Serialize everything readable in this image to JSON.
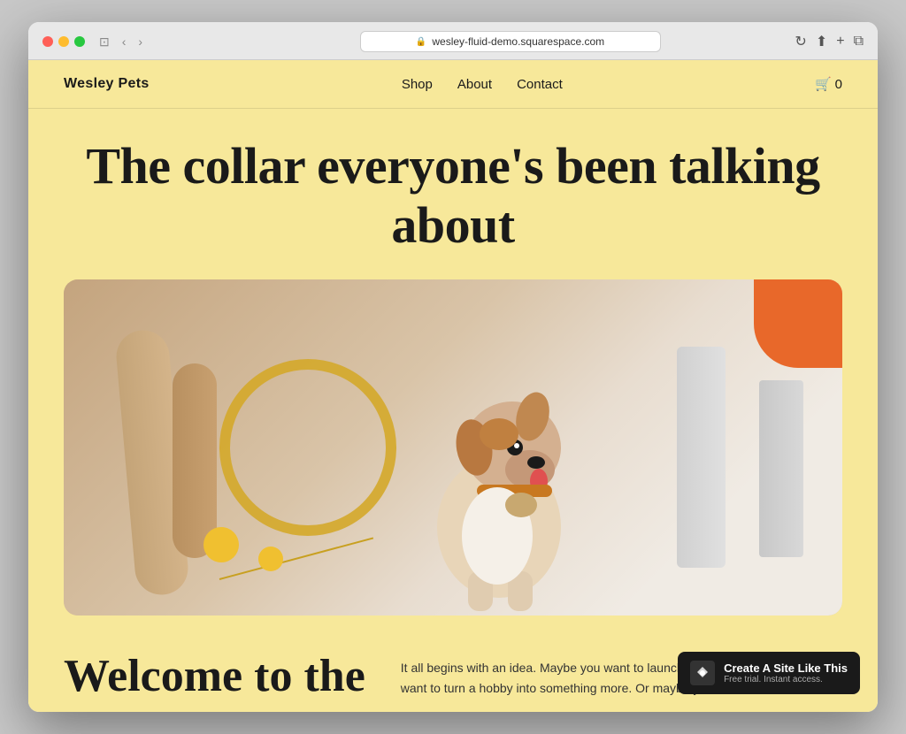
{
  "browser": {
    "url": "wesley-fluid-demo.squarespace.com",
    "back_btn": "‹",
    "forward_btn": "›",
    "refresh_btn": "↻",
    "share_btn": "⬆",
    "new_tab_btn": "+",
    "duplicate_btn": "⧉",
    "window_btn": "⊡"
  },
  "nav": {
    "logo": "Wesley Pets",
    "links": [
      {
        "label": "Shop",
        "href": "#"
      },
      {
        "label": "About",
        "href": "#"
      },
      {
        "label": "Contact",
        "href": "#"
      }
    ],
    "cart_icon": "🛒",
    "cart_count": "0"
  },
  "hero": {
    "title": "The collar everyone's been talking about"
  },
  "welcome": {
    "title": "Welcome to the",
    "body": "It all begins with an idea. Maybe you want to launch a business. Maybe you want to turn a hobby into something more. Or maybe you"
  },
  "badge": {
    "title": "Create A Site Like This",
    "subtitle": "Free trial. Instant access."
  }
}
